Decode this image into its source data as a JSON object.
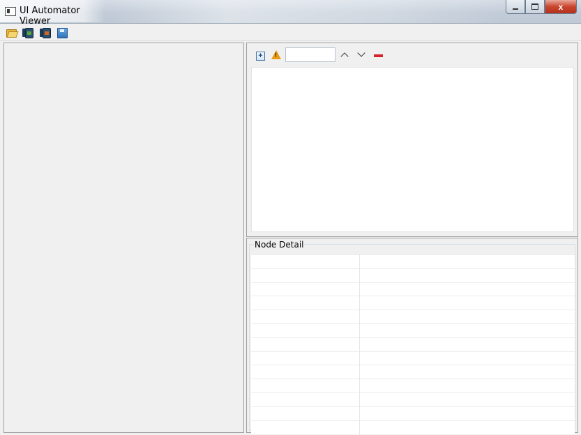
{
  "window": {
    "title": "UI Automator Viewer",
    "controls": {
      "minimize_icon": "minimize-icon",
      "maximize_icon": "maximize-icon",
      "close_label": "x"
    }
  },
  "toolbar": {
    "items": [
      {
        "name": "open",
        "icon": "folder-open-icon"
      },
      {
        "name": "device-screenshot",
        "icon": "device-screenshot-icon"
      },
      {
        "name": "device-screenshot-compressed",
        "icon": "device-screenshot-compressed-icon"
      },
      {
        "name": "save",
        "icon": "save-icon"
      }
    ]
  },
  "hierarchy": {
    "toolbar": {
      "expand_all_icon": "expand-all-icon",
      "warning_icon": "warning-icon",
      "search_value": "",
      "prev_icon": "chevron-up-icon",
      "next_icon": "chevron-down-icon",
      "clear_icon": "minus-icon"
    }
  },
  "node_detail": {
    "title": "Node Detail",
    "rows": [
      "",
      "",
      "",
      "",
      "",
      "",
      "",
      "",
      "",
      "",
      "",
      "",
      ""
    ]
  },
  "colors": {
    "warning": "#e79c12",
    "clear": "#d6232a",
    "close_button": "#c8462e"
  }
}
